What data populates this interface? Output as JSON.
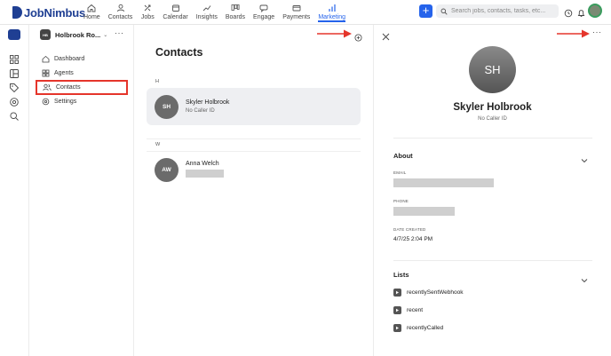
{
  "brand": {
    "name": "JobNimbus",
    "color": "#1f3f93",
    "accent": "#2563eb"
  },
  "nav": [
    {
      "label": "Home",
      "icon": "home-icon"
    },
    {
      "label": "Contacts",
      "icon": "contacts-icon"
    },
    {
      "label": "Jobs",
      "icon": "jobs-icon"
    },
    {
      "label": "Calendar",
      "icon": "calendar-icon"
    },
    {
      "label": "Insights",
      "icon": "insights-icon"
    },
    {
      "label": "Boards",
      "icon": "boards-icon"
    },
    {
      "label": "Engage",
      "icon": "engage-icon"
    },
    {
      "label": "Payments",
      "icon": "payments-icon"
    },
    {
      "label": "Marketing",
      "icon": "marketing-icon",
      "active": true
    }
  ],
  "search": {
    "placeholder": "Search jobs, contacts, tasks, etc..."
  },
  "workspace": {
    "badge": "HB",
    "name": "Holbrook Ro..."
  },
  "sidebar": {
    "items": [
      {
        "label": "Dashboard",
        "icon": "dashboard-icon"
      },
      {
        "label": "Agents",
        "icon": "agents-icon"
      },
      {
        "label": "Contacts",
        "icon": "contacts-icon",
        "active": true
      },
      {
        "label": "Settings",
        "icon": "settings-icon"
      }
    ]
  },
  "contacts": {
    "title": "Contacts",
    "groups": [
      {
        "letter": "H",
        "items": [
          {
            "initials": "SH",
            "name": "Skyler Holbrook",
            "sub": "No Caller ID",
            "selected": true
          }
        ]
      },
      {
        "letter": "W",
        "items": [
          {
            "initials": "AW",
            "name": "Anna Welch",
            "sub": ""
          }
        ]
      }
    ]
  },
  "detail": {
    "initials": "SH",
    "name": "Skyler Holbrook",
    "sub": "No Caller ID",
    "about": {
      "title": "About",
      "email_label": "EMAIL",
      "phone_label": "PHONE",
      "date_label": "DATE CREATED",
      "date_value": "4/7/25 2:04 PM"
    },
    "lists": {
      "title": "Lists",
      "items": [
        "recentlySentWebhook",
        "recent",
        "recentlyCalled"
      ]
    }
  },
  "annotation_color": "#e5352b"
}
